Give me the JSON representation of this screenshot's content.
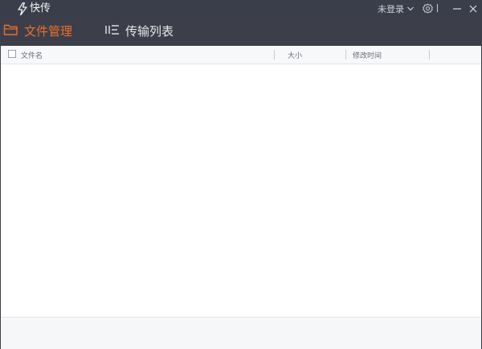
{
  "app": {
    "title": "快传"
  },
  "titlebar": {
    "login_label": "未登录"
  },
  "tabs": [
    {
      "label": "文件管理",
      "active": true
    },
    {
      "label": "传输列表",
      "active": false
    }
  ],
  "file_table": {
    "columns": [
      {
        "label": "文件名"
      },
      {
        "label": "大小"
      },
      {
        "label": "修改时间"
      }
    ],
    "rows": []
  },
  "colors": {
    "accent": "#ec6f2b",
    "titlebar_bg": "#3a3e4a",
    "content_bg": "#ffffff"
  },
  "icons": {
    "logo": "lightning-icon",
    "login_dropdown": "chevron-down-icon",
    "settings": "gear-icon",
    "minimize": "minimize-icon",
    "close": "close-icon",
    "files_tab": "folder-icon",
    "transfer_tab": "transfer-list-icon"
  }
}
